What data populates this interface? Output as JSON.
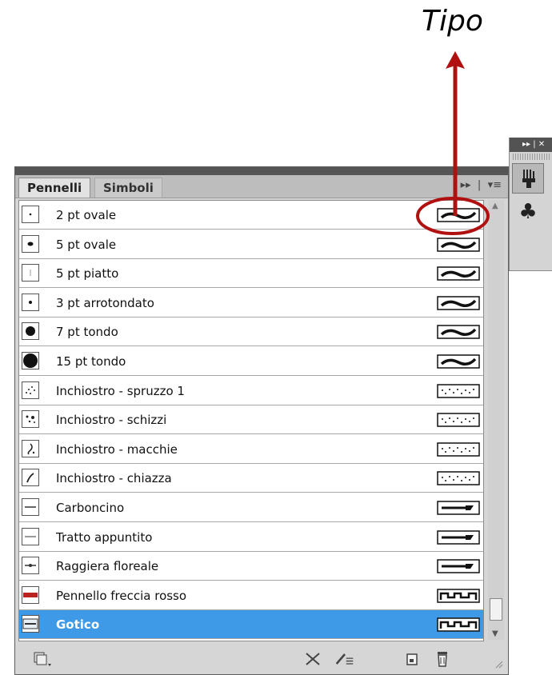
{
  "annotation": {
    "label": "Tipo"
  },
  "panel": {
    "tabs": [
      {
        "label": "Pennelli"
      },
      {
        "label": "Simboli"
      }
    ],
    "brushes": [
      {
        "name": "2 pt ovale",
        "thumb": "tiny-dot-icon",
        "type": "calligraphic"
      },
      {
        "name": "5 pt ovale",
        "thumb": "small-oval-icon",
        "type": "calligraphic"
      },
      {
        "name": "5 pt piatto",
        "thumb": "flat-line-icon",
        "type": "calligraphic"
      },
      {
        "name": "3 pt arrotondato",
        "thumb": "dot-icon",
        "type": "calligraphic"
      },
      {
        "name": "7 pt tondo",
        "thumb": "medium-circle-icon",
        "type": "calligraphic"
      },
      {
        "name": "15 pt tondo",
        "thumb": "large-circle-icon",
        "type": "calligraphic"
      },
      {
        "name": "Inchiostro - spruzzo 1",
        "thumb": "spray-icon",
        "type": "scatter"
      },
      {
        "name": "Inchiostro - schizzi",
        "thumb": "splatter-icon",
        "type": "scatter"
      },
      {
        "name": "Inchiostro - macchie",
        "thumb": "blot-icon",
        "type": "scatter"
      },
      {
        "name": "Inchiostro - chiazza",
        "thumb": "splash-icon",
        "type": "scatter"
      },
      {
        "name": "Carboncino",
        "thumb": "charcoal-line-icon",
        "type": "art"
      },
      {
        "name": "Tratto appuntito",
        "thumb": "tapered-line-icon",
        "type": "art"
      },
      {
        "name": "Raggiera floreale",
        "thumb": "floral-line-icon",
        "type": "art"
      },
      {
        "name": "Pennello freccia rosso",
        "thumb": "red-arrow-line-icon",
        "type": "pattern"
      },
      {
        "name": "Gotico",
        "thumb": "gothic-icon",
        "type": "pattern",
        "selected": true
      }
    ],
    "bottom_icons": [
      "brush-libraries-menu-icon",
      "remove-stroke-icon",
      "brush-options-icon",
      "new-brush-icon",
      "delete-brush-icon"
    ]
  },
  "dock": {
    "icons": [
      "brushes-panel-icon",
      "symbols-panel-icon"
    ]
  },
  "colors": {
    "selection": "#3e9ae6",
    "annotation": "#b01010"
  }
}
